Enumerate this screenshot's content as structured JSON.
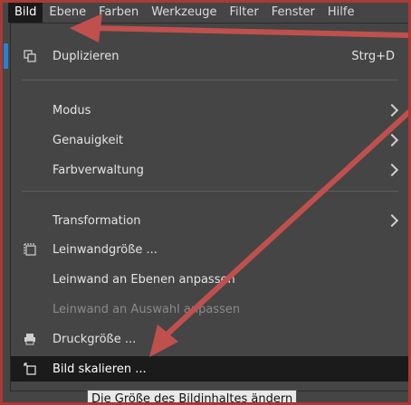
{
  "menubar": {
    "items": [
      "Bild",
      "Ebene",
      "Farben",
      "Werkzeuge",
      "Filter",
      "Fenster",
      "Hilfe"
    ]
  },
  "dropdown": {
    "items": [
      {
        "label": "Duplizieren",
        "shortcut": "Strg+D",
        "icon": "duplicate-icon"
      },
      {
        "label": "Modus",
        "submenu": true
      },
      {
        "label": "Genauigkeit",
        "submenu": true
      },
      {
        "label": "Farbverwaltung",
        "submenu": true
      },
      {
        "label": "Transformation",
        "submenu": true
      },
      {
        "label": "Leinwandgröße ...",
        "icon": "canvas-size-icon"
      },
      {
        "label": "Leinwand an Ebenen anpassen"
      },
      {
        "label": "Leinwand an Auswahl anpassen",
        "disabled": true
      },
      {
        "label": "Druckgröße ...",
        "icon": "printer-icon"
      },
      {
        "label": "Bild skalieren ...",
        "icon": "scale-image-icon",
        "highlighted": true
      }
    ]
  },
  "tooltip": "Die Größe des Bildinhaltes ändern",
  "colors": {
    "annotation_arrow": "#c0504d",
    "highlight_bg": "#1b1b1b",
    "menu_bg": "#454545"
  }
}
